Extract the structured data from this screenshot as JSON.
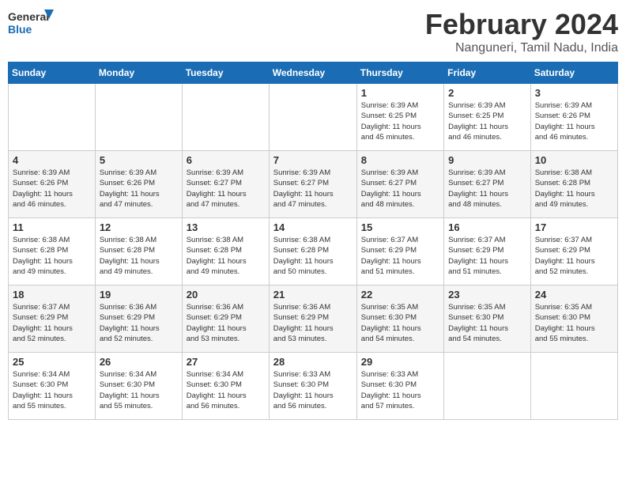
{
  "header": {
    "logo_general": "General",
    "logo_blue": "Blue",
    "month_title": "February 2024",
    "location": "Nanguneri, Tamil Nadu, India"
  },
  "days_of_week": [
    "Sunday",
    "Monday",
    "Tuesday",
    "Wednesday",
    "Thursday",
    "Friday",
    "Saturday"
  ],
  "weeks": [
    [
      {
        "day": "",
        "info": ""
      },
      {
        "day": "",
        "info": ""
      },
      {
        "day": "",
        "info": ""
      },
      {
        "day": "",
        "info": ""
      },
      {
        "day": "1",
        "info": "Sunrise: 6:39 AM\nSunset: 6:25 PM\nDaylight: 11 hours\nand 45 minutes."
      },
      {
        "day": "2",
        "info": "Sunrise: 6:39 AM\nSunset: 6:25 PM\nDaylight: 11 hours\nand 46 minutes."
      },
      {
        "day": "3",
        "info": "Sunrise: 6:39 AM\nSunset: 6:26 PM\nDaylight: 11 hours\nand 46 minutes."
      }
    ],
    [
      {
        "day": "4",
        "info": "Sunrise: 6:39 AM\nSunset: 6:26 PM\nDaylight: 11 hours\nand 46 minutes."
      },
      {
        "day": "5",
        "info": "Sunrise: 6:39 AM\nSunset: 6:26 PM\nDaylight: 11 hours\nand 47 minutes."
      },
      {
        "day": "6",
        "info": "Sunrise: 6:39 AM\nSunset: 6:27 PM\nDaylight: 11 hours\nand 47 minutes."
      },
      {
        "day": "7",
        "info": "Sunrise: 6:39 AM\nSunset: 6:27 PM\nDaylight: 11 hours\nand 47 minutes."
      },
      {
        "day": "8",
        "info": "Sunrise: 6:39 AM\nSunset: 6:27 PM\nDaylight: 11 hours\nand 48 minutes."
      },
      {
        "day": "9",
        "info": "Sunrise: 6:39 AM\nSunset: 6:27 PM\nDaylight: 11 hours\nand 48 minutes."
      },
      {
        "day": "10",
        "info": "Sunrise: 6:38 AM\nSunset: 6:28 PM\nDaylight: 11 hours\nand 49 minutes."
      }
    ],
    [
      {
        "day": "11",
        "info": "Sunrise: 6:38 AM\nSunset: 6:28 PM\nDaylight: 11 hours\nand 49 minutes."
      },
      {
        "day": "12",
        "info": "Sunrise: 6:38 AM\nSunset: 6:28 PM\nDaylight: 11 hours\nand 49 minutes."
      },
      {
        "day": "13",
        "info": "Sunrise: 6:38 AM\nSunset: 6:28 PM\nDaylight: 11 hours\nand 49 minutes."
      },
      {
        "day": "14",
        "info": "Sunrise: 6:38 AM\nSunset: 6:28 PM\nDaylight: 11 hours\nand 50 minutes."
      },
      {
        "day": "15",
        "info": "Sunrise: 6:37 AM\nSunset: 6:29 PM\nDaylight: 11 hours\nand 51 minutes."
      },
      {
        "day": "16",
        "info": "Sunrise: 6:37 AM\nSunset: 6:29 PM\nDaylight: 11 hours\nand 51 minutes."
      },
      {
        "day": "17",
        "info": "Sunrise: 6:37 AM\nSunset: 6:29 PM\nDaylight: 11 hours\nand 52 minutes."
      }
    ],
    [
      {
        "day": "18",
        "info": "Sunrise: 6:37 AM\nSunset: 6:29 PM\nDaylight: 11 hours\nand 52 minutes."
      },
      {
        "day": "19",
        "info": "Sunrise: 6:36 AM\nSunset: 6:29 PM\nDaylight: 11 hours\nand 52 minutes."
      },
      {
        "day": "20",
        "info": "Sunrise: 6:36 AM\nSunset: 6:29 PM\nDaylight: 11 hours\nand 53 minutes."
      },
      {
        "day": "21",
        "info": "Sunrise: 6:36 AM\nSunset: 6:29 PM\nDaylight: 11 hours\nand 53 minutes."
      },
      {
        "day": "22",
        "info": "Sunrise: 6:35 AM\nSunset: 6:30 PM\nDaylight: 11 hours\nand 54 minutes."
      },
      {
        "day": "23",
        "info": "Sunrise: 6:35 AM\nSunset: 6:30 PM\nDaylight: 11 hours\nand 54 minutes."
      },
      {
        "day": "24",
        "info": "Sunrise: 6:35 AM\nSunset: 6:30 PM\nDaylight: 11 hours\nand 55 minutes."
      }
    ],
    [
      {
        "day": "25",
        "info": "Sunrise: 6:34 AM\nSunset: 6:30 PM\nDaylight: 11 hours\nand 55 minutes."
      },
      {
        "day": "26",
        "info": "Sunrise: 6:34 AM\nSunset: 6:30 PM\nDaylight: 11 hours\nand 55 minutes."
      },
      {
        "day": "27",
        "info": "Sunrise: 6:34 AM\nSunset: 6:30 PM\nDaylight: 11 hours\nand 56 minutes."
      },
      {
        "day": "28",
        "info": "Sunrise: 6:33 AM\nSunset: 6:30 PM\nDaylight: 11 hours\nand 56 minutes."
      },
      {
        "day": "29",
        "info": "Sunrise: 6:33 AM\nSunset: 6:30 PM\nDaylight: 11 hours\nand 57 minutes."
      },
      {
        "day": "",
        "info": ""
      },
      {
        "day": "",
        "info": ""
      }
    ]
  ]
}
